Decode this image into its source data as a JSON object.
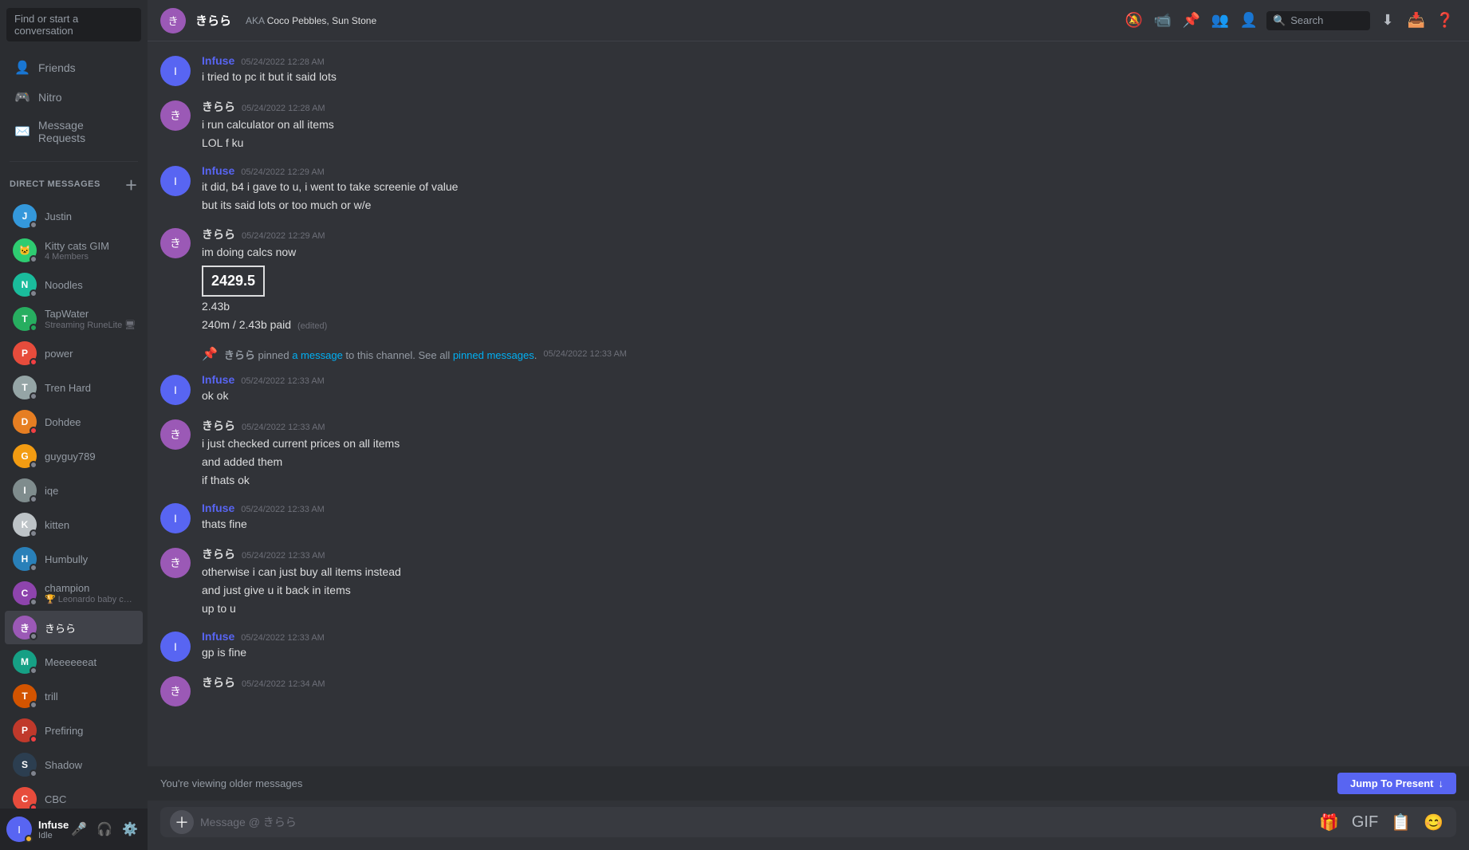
{
  "sidebar": {
    "search_placeholder": "Find or start a conversation",
    "nav_items": [
      {
        "id": "friends",
        "label": "Friends",
        "icon": "👤"
      },
      {
        "id": "nitro",
        "label": "Nitro",
        "icon": "🎮"
      },
      {
        "id": "message-requests",
        "label": "Message Requests",
        "icon": "✉️"
      }
    ],
    "dm_header": "DIRECT MESSAGES",
    "dm_plus_title": "Create DM",
    "dm_list": [
      {
        "id": "justin",
        "name": "Justin",
        "status": "offline",
        "sub": "",
        "avatarColor": "#3498db",
        "avatarText": "J"
      },
      {
        "id": "kitty",
        "name": "Kitty cats GIM",
        "status": "offline",
        "sub": "4 Members",
        "isGroup": true,
        "avatarColor": "#2ecc71",
        "avatarText": "🐱"
      },
      {
        "id": "noodles",
        "name": "Noodles",
        "status": "offline",
        "sub": "",
        "avatarColor": "#1abc9c",
        "avatarText": "N"
      },
      {
        "id": "tapwater",
        "name": "TapWater",
        "status": "online",
        "sub": "Streaming RuneLite 🖥",
        "avatarColor": "#27ae60",
        "avatarText": "T"
      },
      {
        "id": "power",
        "name": "power",
        "status": "dnd",
        "sub": "",
        "avatarColor": "#e74c3c",
        "avatarText": "P"
      },
      {
        "id": "tren",
        "name": "Tren Hard",
        "status": "offline",
        "sub": "",
        "avatarColor": "#95a5a6",
        "avatarText": "T"
      },
      {
        "id": "dohdee",
        "name": "Dohdee",
        "status": "dnd",
        "sub": "",
        "avatarColor": "#e67e22",
        "avatarText": "D"
      },
      {
        "id": "guyguy",
        "name": "guyguy789",
        "status": "offline",
        "sub": "",
        "avatarColor": "#f39c12",
        "avatarText": "G"
      },
      {
        "id": "iqe",
        "name": "iqe",
        "status": "offline",
        "sub": "",
        "avatarColor": "#7f8c8d",
        "avatarText": "I"
      },
      {
        "id": "kitten",
        "name": "kitten",
        "status": "offline",
        "sub": "",
        "avatarColor": "#bdc3c7",
        "avatarText": "K"
      },
      {
        "id": "humbully",
        "name": "Humbully",
        "status": "offline",
        "sub": "",
        "avatarColor": "#2980b9",
        "avatarText": "H"
      },
      {
        "id": "champion",
        "name": "champion",
        "status": "offline",
        "sub": "🏆 Leonardo baby can you co...",
        "avatarColor": "#8e44ad",
        "avatarText": "C"
      },
      {
        "id": "kirara",
        "name": "きらら",
        "status": "offline",
        "sub": "",
        "avatarColor": "#9b59b6",
        "avatarText": "き",
        "active": true
      },
      {
        "id": "meee",
        "name": "Meeeeeeat",
        "status": "offline",
        "sub": "",
        "avatarColor": "#16a085",
        "avatarText": "M"
      },
      {
        "id": "trill",
        "name": "trill",
        "status": "offline",
        "sub": "",
        "avatarColor": "#d35400",
        "avatarText": "T"
      },
      {
        "id": "prefiring",
        "name": "Prefiring",
        "status": "dnd",
        "sub": "",
        "avatarColor": "#c0392b",
        "avatarText": "P"
      },
      {
        "id": "shadow",
        "name": "Shadow",
        "status": "offline",
        "sub": "",
        "avatarColor": "#2c3e50",
        "avatarText": "S"
      },
      {
        "id": "cbc",
        "name": "CBC",
        "status": "dnd",
        "sub": "",
        "avatarColor": "#e74c3c",
        "avatarText": "C"
      }
    ]
  },
  "user_panel": {
    "name": "Infuse",
    "status": "Idle",
    "avatarText": "I",
    "avatarColor": "#5865f2"
  },
  "header": {
    "avatar_text": "き",
    "avatar_color": "#9b59b6",
    "username": "きらら",
    "aka_label": "AKA",
    "aka_names": "Coco Pebbles, Sun Stone",
    "search_placeholder": "Search",
    "icons": [
      "📵",
      "📹",
      "📌",
      "👥",
      "👤"
    ]
  },
  "messages": [
    {
      "id": "msg1",
      "author": "Infuse",
      "author_type": "infuse",
      "timestamp": "05/24/2022 12:28 AM",
      "lines": [
        "i tried to pc it but it said lots"
      ],
      "avatarText": "I",
      "avatarColor": "#5865f2"
    },
    {
      "id": "msg2",
      "author": "きらら",
      "author_type": "kirara",
      "timestamp": "05/24/2022 12:28 AM",
      "lines": [
        "i run calculator on all items",
        "LOL f ku"
      ],
      "avatarText": "き",
      "avatarColor": "#9b59b6"
    },
    {
      "id": "msg3",
      "author": "Infuse",
      "author_type": "infuse",
      "timestamp": "05/24/2022 12:29 AM",
      "lines": [
        "it did, b4 i gave to u, i went to take screenie of value",
        "but its said lots or too much or w/e"
      ],
      "avatarText": "I",
      "avatarColor": "#5865f2"
    },
    {
      "id": "msg4",
      "author": "きらら",
      "author_type": "kirara",
      "timestamp": "05/24/2022 12:29 AM",
      "lines": [
        "im doing calcs now"
      ],
      "has_number_box": true,
      "number_box_value": "2429.5",
      "extra_lines": [
        "2.43b",
        "240m / 2.43b paid"
      ],
      "edited": true,
      "avatarText": "き",
      "avatarColor": "#9b59b6"
    },
    {
      "id": "pinned",
      "type": "pinned",
      "pinner": "きらら",
      "pinned_text": "a message",
      "channel_text": "to this channel. See all",
      "pinned_messages_link": "pinned messages",
      "timestamp": "05/24/2022 12:33 AM"
    },
    {
      "id": "msg5",
      "author": "Infuse",
      "author_type": "infuse",
      "timestamp": "05/24/2022 12:33 AM",
      "lines": [
        "ok ok"
      ],
      "avatarText": "I",
      "avatarColor": "#5865f2"
    },
    {
      "id": "msg6",
      "author": "きらら",
      "author_type": "kirara",
      "timestamp": "05/24/2022 12:33 AM",
      "lines": [
        "i just checked current prices on all items",
        "and added them",
        "if thats ok"
      ],
      "avatarText": "き",
      "avatarColor": "#9b59b6"
    },
    {
      "id": "msg7",
      "author": "Infuse",
      "author_type": "infuse",
      "timestamp": "05/24/2022 12:33 AM",
      "lines": [
        "thats fine"
      ],
      "avatarText": "I",
      "avatarColor": "#5865f2"
    },
    {
      "id": "msg8",
      "author": "きらら",
      "author_type": "kirara",
      "timestamp": "05/24/2022 12:33 AM",
      "lines": [
        "otherwise i can just buy all items instead",
        "and just give u it back in items",
        "up to u"
      ],
      "avatarText": "き",
      "avatarColor": "#9b59b6"
    },
    {
      "id": "msg9",
      "author": "Infuse",
      "author_type": "infuse",
      "timestamp": "05/24/2022 12:33 AM",
      "lines": [
        "gp is fine"
      ],
      "avatarText": "I",
      "avatarColor": "#5865f2"
    },
    {
      "id": "msg10",
      "author": "きらら",
      "author_type": "kirara",
      "timestamp": "05/24/2022 12:34 AM",
      "lines": [],
      "avatarText": "き",
      "avatarColor": "#9b59b6",
      "partial": true
    }
  ],
  "viewing_older": {
    "text": "You're viewing older messages",
    "jump_button": "Jump To Present",
    "jump_arrow": "↓"
  },
  "input": {
    "placeholder": "Message @ きらら"
  }
}
